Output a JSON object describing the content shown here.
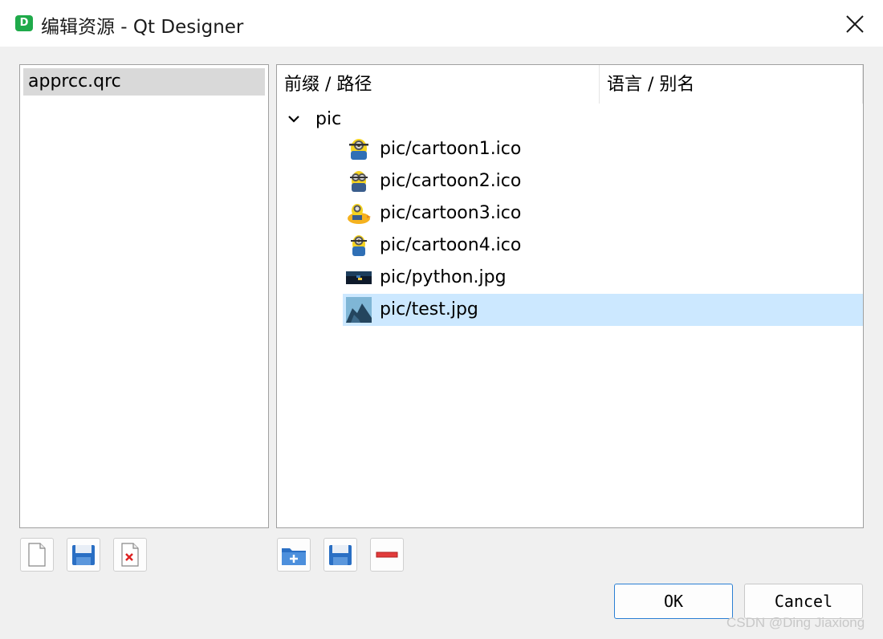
{
  "window": {
    "app_icon_letter": "D",
    "title": "编辑资源 - Qt Designer"
  },
  "resource_files": {
    "items": [
      {
        "label": "apprcc.qrc",
        "selected": true
      }
    ]
  },
  "tree": {
    "headers": [
      "前缀 / 路径",
      "语言 / 别名"
    ],
    "prefix": "pic",
    "files": [
      {
        "label": "pic/cartoon1.ico",
        "icon": "minion-icon"
      },
      {
        "label": "pic/cartoon2.ico",
        "icon": "minion-icon"
      },
      {
        "label": "pic/cartoon3.ico",
        "icon": "minion-duck-icon"
      },
      {
        "label": "pic/cartoon4.ico",
        "icon": "minion-icon"
      },
      {
        "label": "pic/python.jpg",
        "icon": "python-image-icon"
      },
      {
        "label": "pic/test.jpg",
        "icon": "landscape-image-icon",
        "selected": true
      }
    ]
  },
  "toolbar_left": [
    {
      "name": "new-file-icon"
    },
    {
      "name": "open-file-icon"
    },
    {
      "name": "remove-file-icon"
    }
  ],
  "toolbar_right": [
    {
      "name": "add-prefix-icon"
    },
    {
      "name": "add-files-icon"
    },
    {
      "name": "remove-icon"
    }
  ],
  "buttons": {
    "ok": "OK",
    "cancel": "Cancel"
  },
  "watermark": "CSDN @Ding Jiaxiong",
  "colors": {
    "selection": "#cce8ff",
    "accent": "#2a7fd4"
  }
}
